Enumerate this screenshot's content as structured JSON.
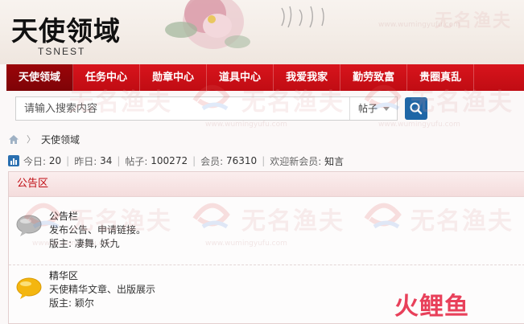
{
  "site": {
    "logo_cn": "天使领域",
    "logo_en": "TSNEST"
  },
  "nav": {
    "items": [
      {
        "label": "天使领域",
        "active": true
      },
      {
        "label": "任务中心",
        "active": false
      },
      {
        "label": "勋章中心",
        "active": false
      },
      {
        "label": "道具中心",
        "active": false
      },
      {
        "label": "我爱我家",
        "active": false
      },
      {
        "label": "勤劳致富",
        "active": false
      },
      {
        "label": "贵圈真乱",
        "active": false
      }
    ]
  },
  "search": {
    "placeholder": "请输入搜索内容",
    "type_label": "帖子"
  },
  "breadcrumb": {
    "current": "天使领域"
  },
  "stats": {
    "today_label": "今日:",
    "today": "20",
    "yesterday_label": "昨日:",
    "yesterday": "34",
    "posts_label": "帖子:",
    "posts": "100272",
    "members_label": "会员:",
    "members": "76310",
    "newest_label": "欢迎新会员:",
    "newest": "知言"
  },
  "section": {
    "title": "公告区",
    "forums": [
      {
        "name": "公告栏",
        "desc": "发布公告、申请链接。",
        "mod_label": "版主:",
        "mods": "凄舞, 妖九",
        "icon": "speech-bubble-gray-icon"
      },
      {
        "name": "精华区",
        "desc": "天使精华文章、出版展示",
        "mod_label": "版主:",
        "mods": "颖尔",
        "icon": "speech-bubble-yellow-icon"
      }
    ]
  },
  "watermark": {
    "text": "无名渔夫",
    "url": "www.wumingyufu.com"
  },
  "brand": {
    "text": "火鲤鱼"
  },
  "colors": {
    "nav_red": "#c00c13",
    "nav_active": "#8a0409",
    "search_button": "#1f66a6",
    "section_title": "#c00c13"
  }
}
